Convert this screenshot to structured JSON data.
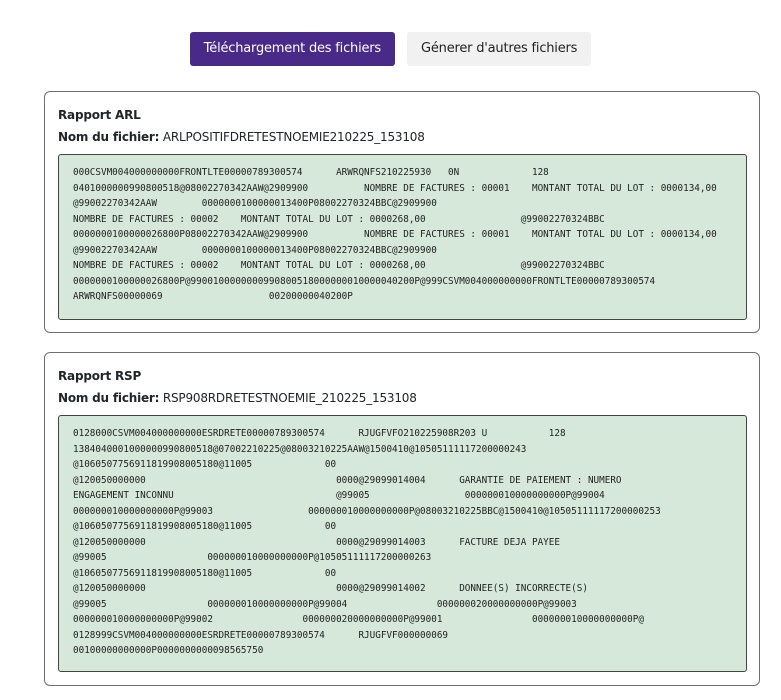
{
  "tabs": {
    "download_label": "Téléchargement des fichiers",
    "generate_label": "Génerer d'autres fichiers"
  },
  "arl": {
    "title": "Rapport ARL",
    "file_label": "Nom du fichier:",
    "file_name": "ARLPOSITIFDRETESTNOEMIE210225_153108",
    "content": "000CSVM004000000000FRONTLTE00000789300574      ARWRQNFS210225930   0N             128\n0401000000990800518@08002270342AAW@2909900          NOMBRE DE FACTURES : 00001    MONTANT TOTAL DU LOT : 0000134,00                 @99002270342AAW        0000000100000013400P08002270324BBC@2909900\nNOMBRE DE FACTURES : 00002    MONTANT TOTAL DU LOT : 0000268,00                 @99002270324BBC\n0000000100000026800P08002270342AAW@2909900          NOMBRE DE FACTURES : 00001    MONTANT TOTAL DU LOT : 0000134,00                 @99002270342AAW        0000000100000013400P08002270324BBC@2909900\nNOMBRE DE FACTURES : 00002    MONTANT TOTAL DU LOT : 0000268,00                 @99002270324BBC\n0000000100000026800P@9900100000000990800518000000010000040200P@999CSVM004000000000FRONTLTE00000789300574\nARWRQNFS00000069                   00200000040200P"
  },
  "rsp": {
    "title": "Rapport RSP",
    "file_label": "Nom du fichier:",
    "file_name": "RSP908RDRETESTNOEMIE_210225_153108",
    "content": "0128000CSVM004000000000ESRDRETE00000789300574      RJUGFVFO210225908R203 U           128\n1384040001000000990800518@07002210225@08003210225AAW@1500410@10505111117200000243\n@1060507756911819908005180@11005             00\n@120050000000                                  0000@29099014004      GARANTIE DE PAIEMENT : NUMERO\nENGAGEMENT INCONNU                             @99005                 000000010000000000P@99004\n000000010000000000P@99003                 000000010000000000P@08003210225BBC@1500410@10505111117200000253\n@1060507756911819908005180@11005             00\n@120050000000                                  0000@29099014003      FACTURE DEJA PAYEE\n@99005                  000000010000000000P@10505111117200000263\n@1060507756911819908005180@11005             00\n@120050000000                                  0000@29099014002      DONNEE(S) INCORRECTE(S)\n@99005                  000000010000000000P@99004                000000020000000000P@99003\n000000010000000000P@99002                000000020000000000P@99001                000000010000000000P@\n0128999CSVM004000000000ESRDRETE00000789300574      RJUGFVF000000069\n00100000000000P0000000000098565750"
  }
}
